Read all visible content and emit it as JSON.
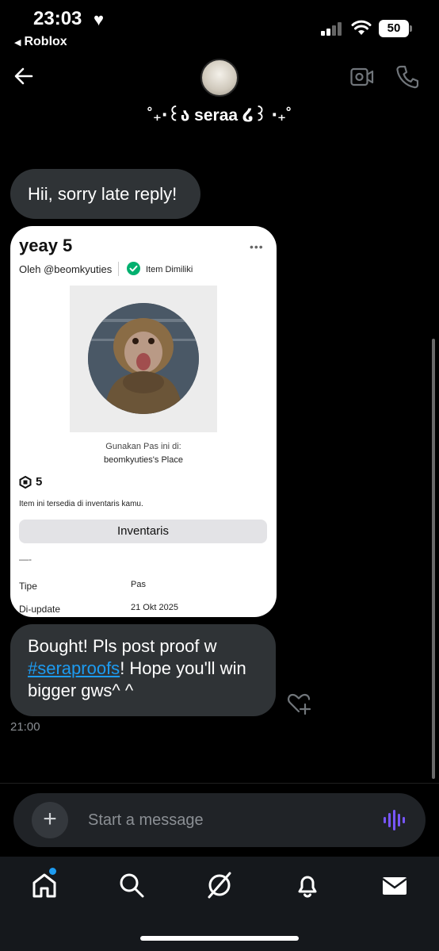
{
  "status_bar": {
    "time": "23:03",
    "back_app": "Roblox",
    "battery": "50"
  },
  "header": {
    "contact_name": "˚₊‧꒰ა seraa ໒꒱ ‧₊˚"
  },
  "messages": {
    "m1": "Hii, sorry late reply!",
    "m2_before": "Bought! Pls post proof w ",
    "m2_hashtag": "#seraproofs",
    "m2_after": "! Hope you'll win bigger gws^ ^",
    "timestamp": "21:00"
  },
  "shared_card": {
    "title": "yeay 5",
    "by": "Oleh @beomkyuties",
    "owned_label": "Item Dimiliki",
    "use_label": "Gunakan Pas ini di:",
    "place": "beomkyuties's Place",
    "price": "5",
    "availability": "Item ini tersedia di inventaris kamu.",
    "inventory_button": "Inventaris",
    "dash": "—-",
    "details": [
      {
        "key": "Tipe",
        "value": "Pas"
      },
      {
        "key": "Di-update",
        "value": "21 Okt 2025"
      }
    ]
  },
  "composer": {
    "placeholder": "Start a message"
  },
  "colors": {
    "accent": "#1d9bf0",
    "bubble": "#2f3336",
    "background": "#000000",
    "voice": "#7856ff"
  },
  "icons": [
    "back-arrow-icon",
    "video-call-icon",
    "phone-icon",
    "plus-icon",
    "voice-icon",
    "home-icon",
    "search-icon",
    "grok-icon",
    "bell-icon",
    "mail-icon",
    "heart-plus-icon",
    "robux-icon",
    "check-icon"
  ]
}
